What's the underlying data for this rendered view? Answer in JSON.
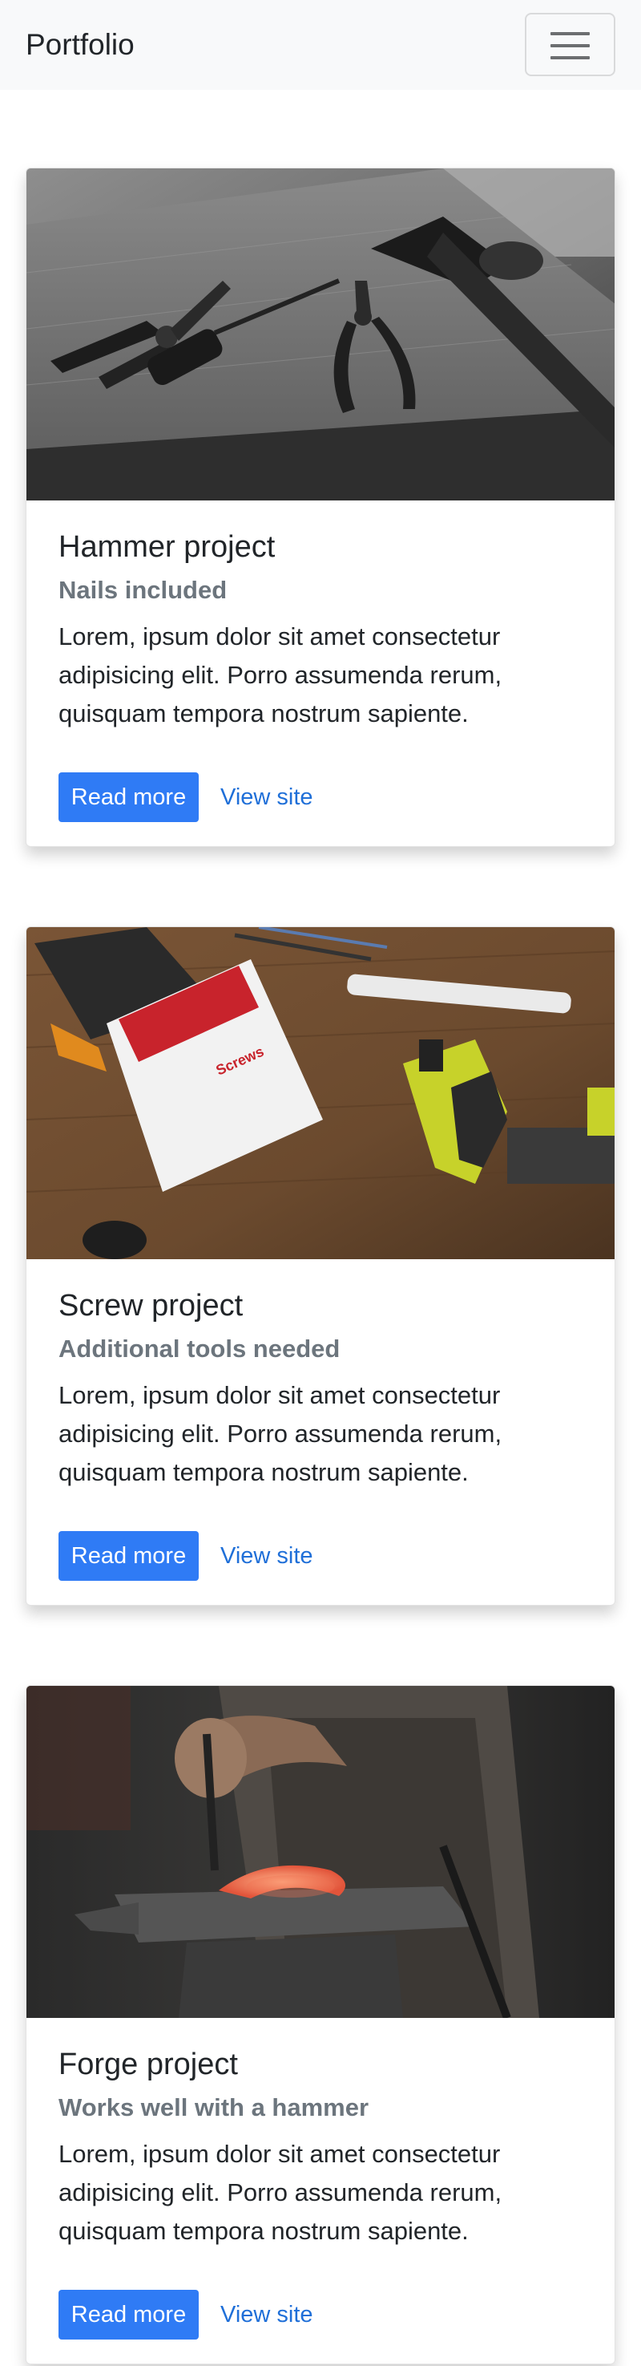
{
  "navbar": {
    "brand": "Portfolio",
    "toggler_icon": "hamburger-icon"
  },
  "cards": [
    {
      "title": "Hammer project",
      "subtitle": "Nails included",
      "text": "Lorem, ipsum dolor sit amet consectetur adipisicing elit. Porro assumenda rerum, quisquam tempora nostrum sapiente.",
      "read_more": "Read more",
      "view_site": "View site",
      "image": "hand-tools-on-wooden-plank"
    },
    {
      "title": "Screw project",
      "subtitle": "Additional tools needed",
      "text": "Lorem, ipsum dolor sit amet consectetur adipisicing elit. Porro assumenda rerum, quisquam tempora nostrum sapiente.",
      "read_more": "Read more",
      "view_site": "View site",
      "image": "cordless-drill-and-screw-boxes",
      "box_text": "Screws"
    },
    {
      "title": "Forge project",
      "subtitle": "Works well with a hammer",
      "text": "Lorem, ipsum dolor sit amet consectetur adipisicing elit. Porro assumenda rerum, quisquam tempora nostrum sapiente.",
      "read_more": "Read more",
      "view_site": "View site",
      "image": "blacksmith-horseshoe-on-anvil"
    }
  ],
  "colors": {
    "navbar_bg": "#f8f9fa",
    "primary": "#2f7bf5",
    "link": "#1f6fd8",
    "muted": "#6c757d"
  }
}
